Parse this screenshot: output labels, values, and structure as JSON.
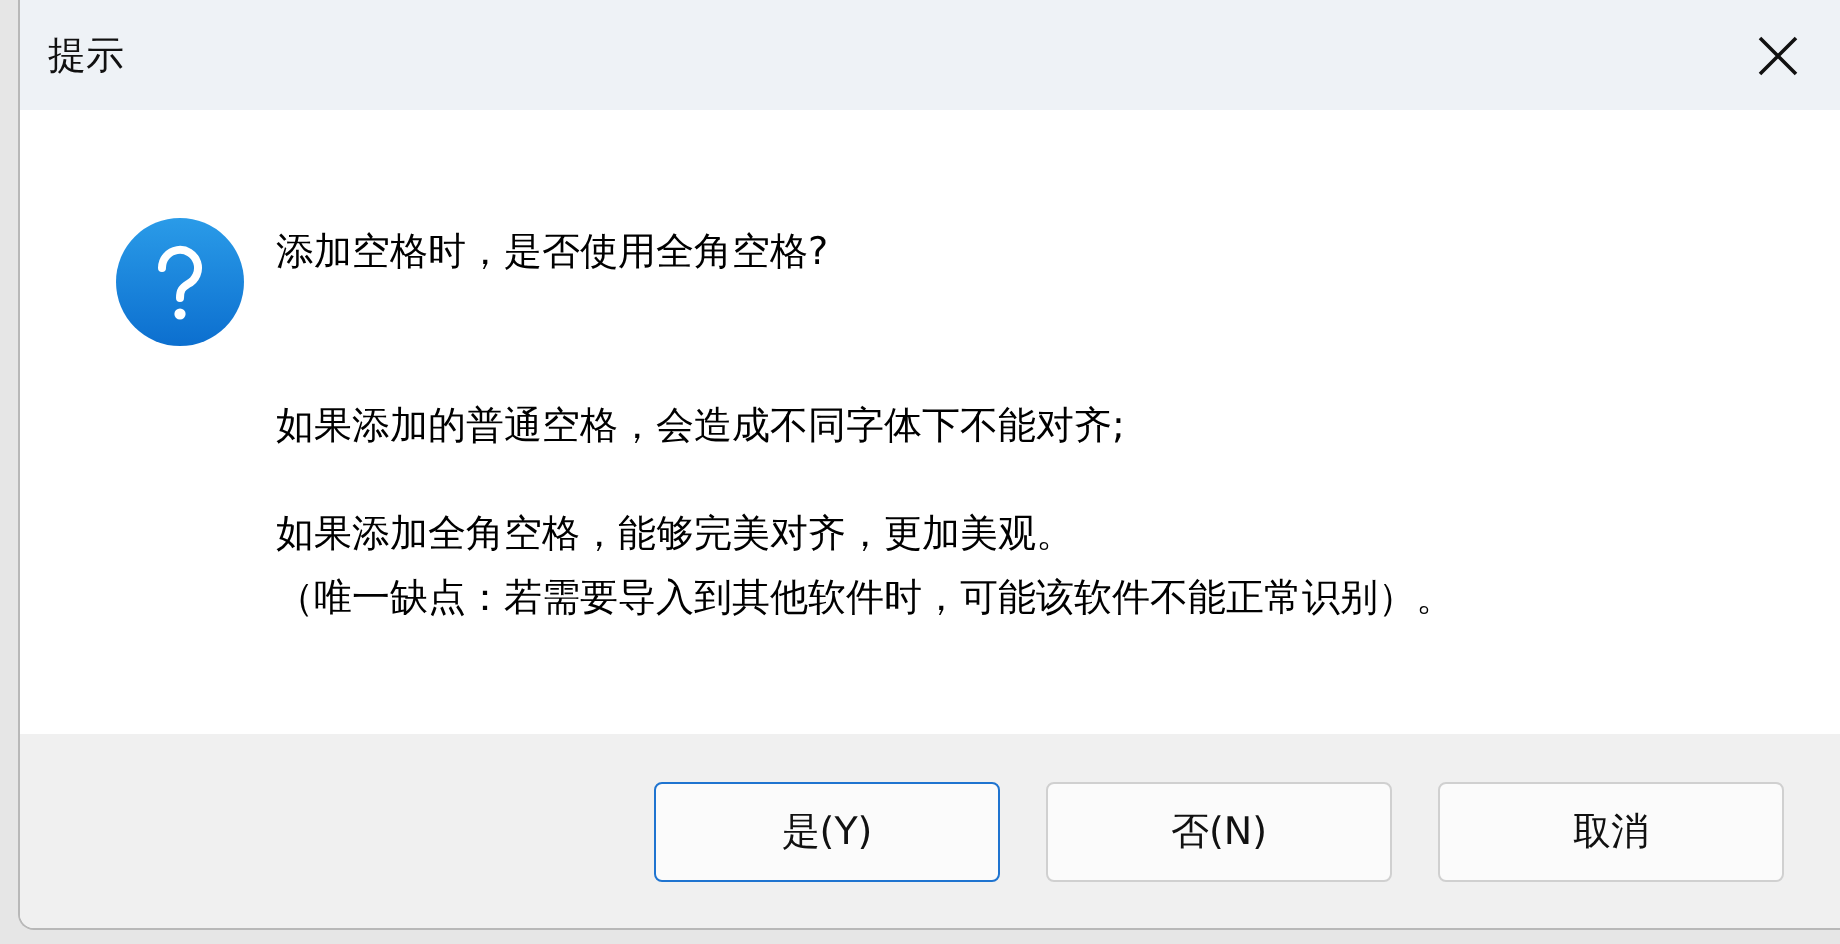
{
  "window": {
    "title": "提示"
  },
  "message": {
    "question": "添加空格时，是否使用全角空格?",
    "paragraphs": [
      [
        "如果添加的普通空格，会造成不同字体下不能对齐;"
      ],
      [
        "如果添加全角空格，能够完美对齐，更加美观。",
        "（唯一缺点：若需要导入到其他软件时，可能该软件不能正常识别）。"
      ]
    ]
  },
  "buttons": [
    {
      "label": "是(Y)",
      "focused": true
    },
    {
      "label": "否(N)",
      "focused": false
    },
    {
      "label": "取消",
      "focused": false
    }
  ]
}
